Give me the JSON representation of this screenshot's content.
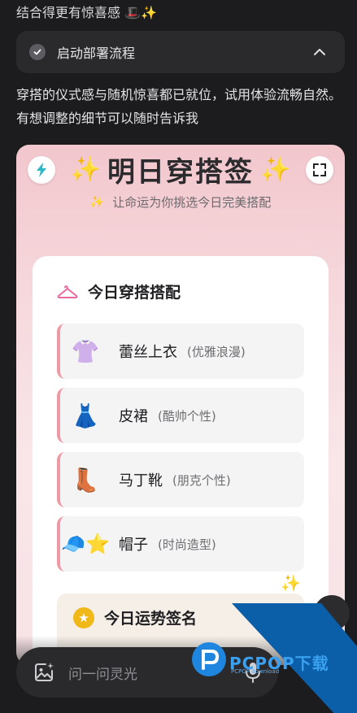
{
  "top_line": "结合得更有惊喜感 🎩✨",
  "deploy": {
    "label": "启动部署流程"
  },
  "reply_text": "穿搭的仪式感与随机惊喜都已就位，试用体验流畅自然。有想调整的细节可以随时告诉我",
  "card": {
    "title": "明日穿搭签",
    "title_sparkle": "✨",
    "subtitle": "让命运为你挑选今日完美搭配",
    "subtitle_sparkle": "✨",
    "section_title": "今日穿搭搭配",
    "items": [
      {
        "emoji": "👚",
        "name": "蕾丝上衣",
        "note": "(优雅浪漫)"
      },
      {
        "emoji": "👗",
        "name": "皮裙",
        "note": "(酷帅个性)"
      },
      {
        "emoji": "👢",
        "name": "马丁靴",
        "note": "(朋克个性)"
      },
      {
        "emoji": "🧢⭐",
        "name": "帽子",
        "note": "(时尚造型)"
      }
    ],
    "fortune_title": "今日运势签名",
    "fortune_star": "★"
  },
  "floating_sparkle": "✨",
  "input": {
    "placeholder": "问一问灵光"
  },
  "watermark": {
    "text": "PCPOP下载",
    "sub": "PCPOP download"
  },
  "colors": {
    "accent_pink": "#ee9aa6",
    "card_top": "#f2c7cd",
    "watermark_blue": "#0b5ea8"
  }
}
